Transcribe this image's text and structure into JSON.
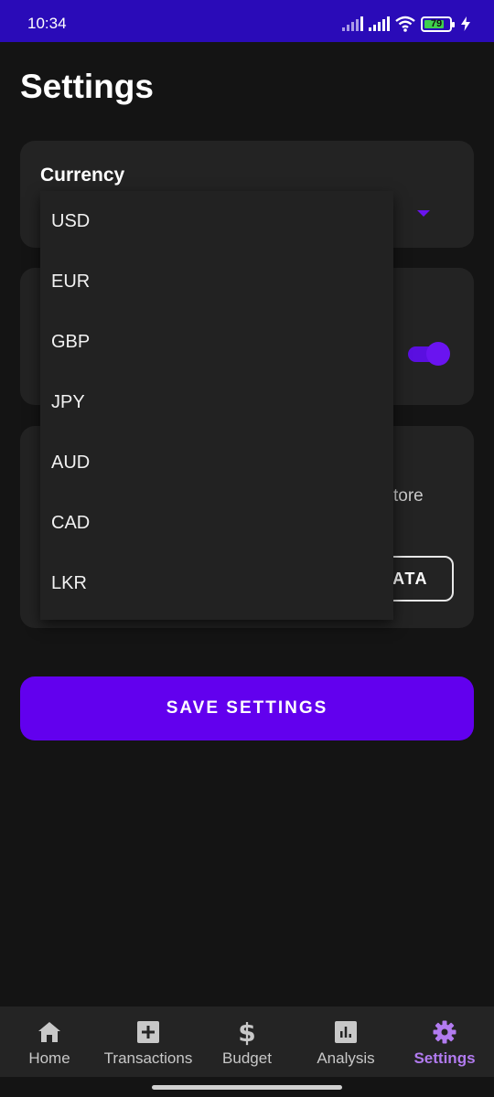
{
  "status_bar": {
    "time": "10:34",
    "battery_level": "79",
    "battery_fraction": 0.79,
    "icons": [
      "signal-icon",
      "signal-icon",
      "wifi-icon",
      "battery-icon",
      "charging-icon"
    ]
  },
  "page": {
    "title": "Settings"
  },
  "currency_card": {
    "label": "Currency",
    "dropdown_open": true,
    "options": [
      "USD",
      "EUR",
      "GBP",
      "JPY",
      "AUD",
      "CAD",
      "LKR"
    ]
  },
  "toggle_card": {
    "toggle_on": true
  },
  "data_card": {
    "partial_text": "tore",
    "button_partial_label": "ATA"
  },
  "save_button": {
    "label": "SAVE SETTINGS"
  },
  "bottom_nav": {
    "items": [
      {
        "label": "Home",
        "icon": "home-icon"
      },
      {
        "label": "Transactions",
        "icon": "plus-box-icon"
      },
      {
        "label": "Budget",
        "icon": "dollar-icon"
      },
      {
        "label": "Analysis",
        "icon": "bar-chart-icon"
      },
      {
        "label": "Settings",
        "icon": "gear-icon",
        "active": true
      }
    ]
  },
  "colors": {
    "status_bar": "#2a0bb8",
    "accent": "#6200ee",
    "active_nav": "#b27bf0",
    "background": "#141414",
    "card": "#232323"
  }
}
